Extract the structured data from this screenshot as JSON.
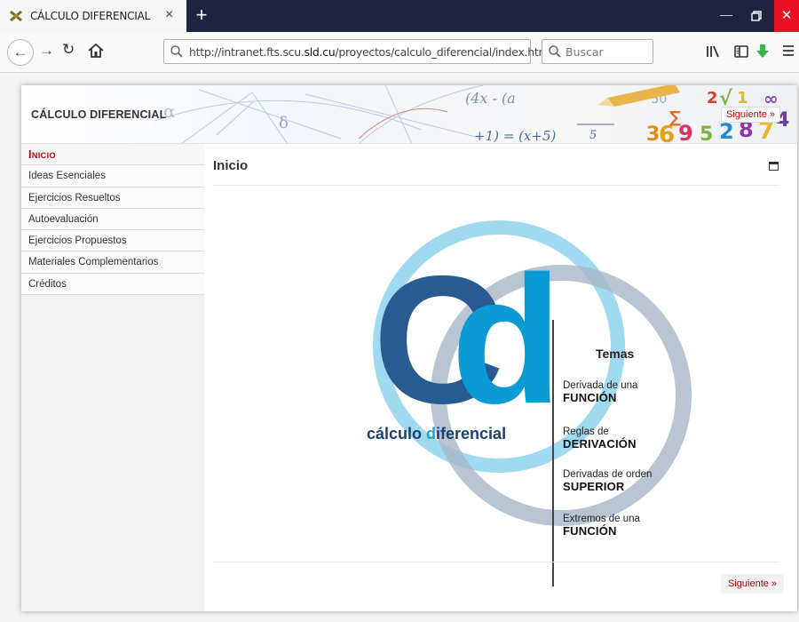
{
  "browser": {
    "tab_title": "CÁLCULO DIFERENCIAL",
    "tab_close": "×",
    "new_tab": "+",
    "url_prefix": "http://intranet.fts.scu.",
    "url_domain": "sld.cu",
    "url_suffix": "/proyectos/calculo_diferencial/index.html",
    "search_placeholder": "Buscar",
    "icons": [
      "favicon",
      "back-icon",
      "forward-icon",
      "reload-icon",
      "home-icon",
      "page-info-icon",
      "search-icon",
      "library-icon",
      "sidebar-icon",
      "download-icon",
      "menu-icon",
      "minimize-icon",
      "restore-icon",
      "close-icon"
    ]
  },
  "banner": {
    "title": "CÁLCULO DIFERENCIAL",
    "next_label": "Siguiente »"
  },
  "sidebar": {
    "items": [
      {
        "label": "Inicio",
        "active": true
      },
      {
        "label": "Ideas Esenciales"
      },
      {
        "label": "Ejercicios Resueltos"
      },
      {
        "label": "Autoevaluación"
      },
      {
        "label": "Ejercicios Propuestos"
      },
      {
        "label": "Materiales Complementarios"
      },
      {
        "label": "Créditos"
      }
    ]
  },
  "main": {
    "title": "Inicio",
    "next_label": "Siguiente »",
    "logo": {
      "letter_c": "C",
      "letter_d": "d",
      "word_a": "cálculo ",
      "word_accent": "d",
      "word_b": "iferencial",
      "temas_title": "Temas",
      "topics": [
        {
          "line1": "Derivada de una",
          "line2": "FUNCIÓN"
        },
        {
          "line1": "Reglas de",
          "line2": "DERIVACIÓN"
        },
        {
          "line1": "Derivadas de orden",
          "line2": "SUPERIOR"
        },
        {
          "line1": "Extremos de una",
          "line2": "FUNCIÓN"
        }
      ]
    }
  },
  "colors": {
    "accent_red": "#c00000",
    "logo_dark_blue": "#275b92",
    "logo_light_blue": "#0b9ad4",
    "ring_light": "#8fd3ee",
    "ring_grey": "#a9b7c9",
    "titlebar": "#202340"
  }
}
